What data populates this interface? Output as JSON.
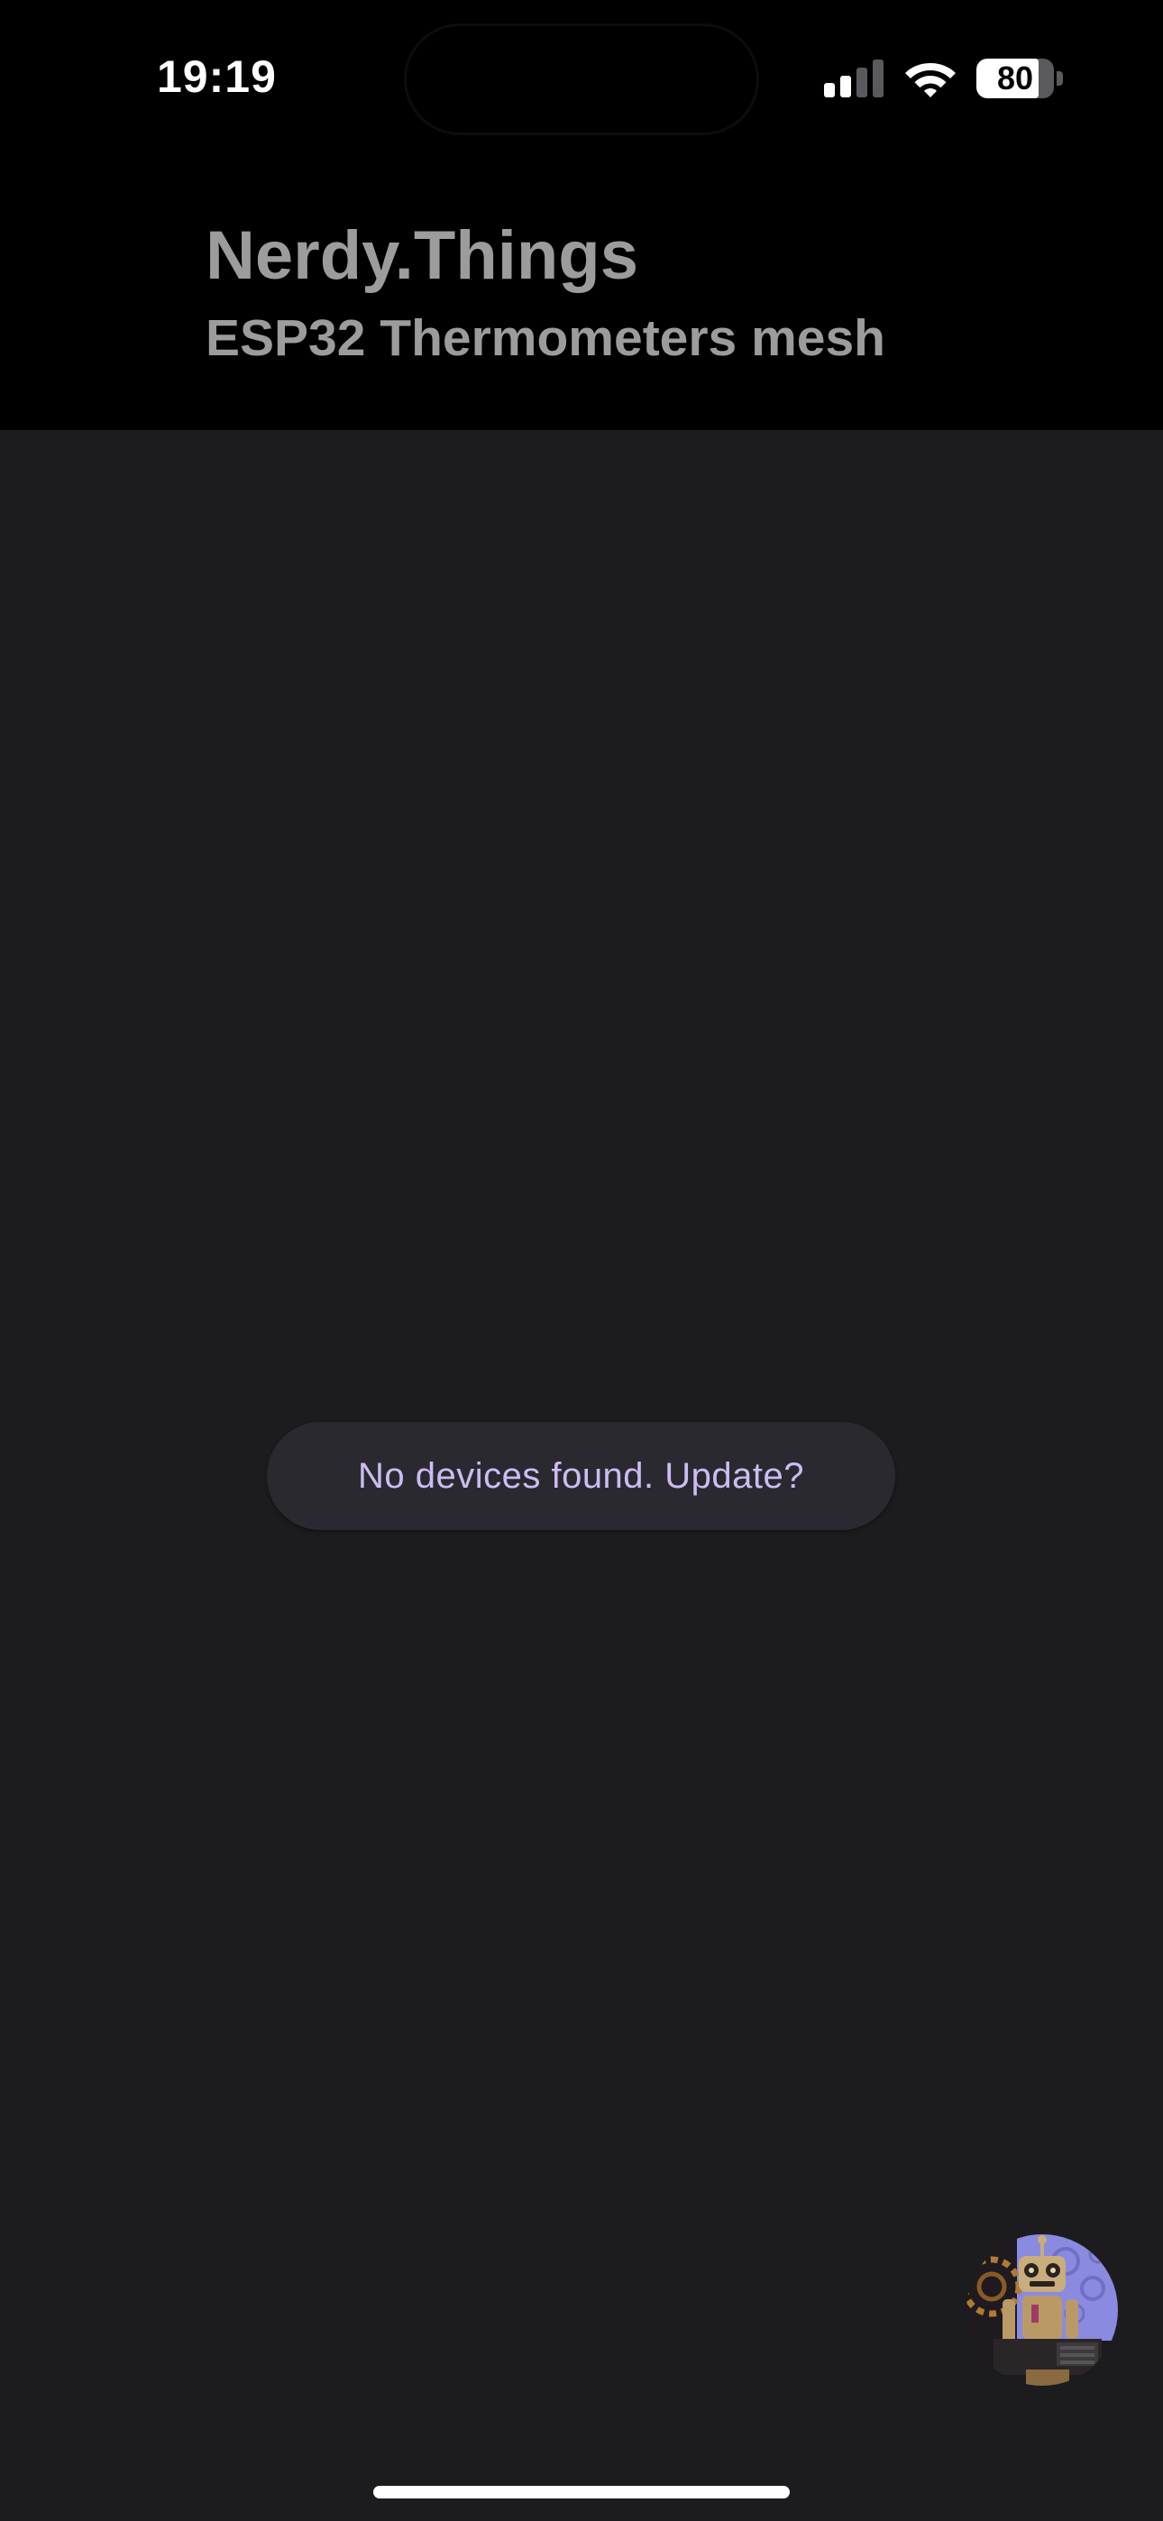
{
  "status_bar": {
    "time": "19:19",
    "battery_level": "80",
    "battery_fraction": 0.8,
    "signal_bars_active": 2,
    "signal_bars_total": 4
  },
  "header": {
    "title": "Nerdy.Things",
    "subtitle": "ESP32 Thermometers mesh"
  },
  "main": {
    "update_button_label": "No devices found. Update?"
  },
  "icons": {
    "signal": "cellular-signal-icon",
    "wifi": "wifi-icon",
    "battery": "battery-icon",
    "avatar": "robot-avatar"
  },
  "colors": {
    "background": "#1c1c1e",
    "header_background": "#000000",
    "title_text": "#9c9c9c",
    "button_background": "#2a2930",
    "button_text": "#cdbcf2",
    "avatar_accent": "#8a8ae0"
  }
}
